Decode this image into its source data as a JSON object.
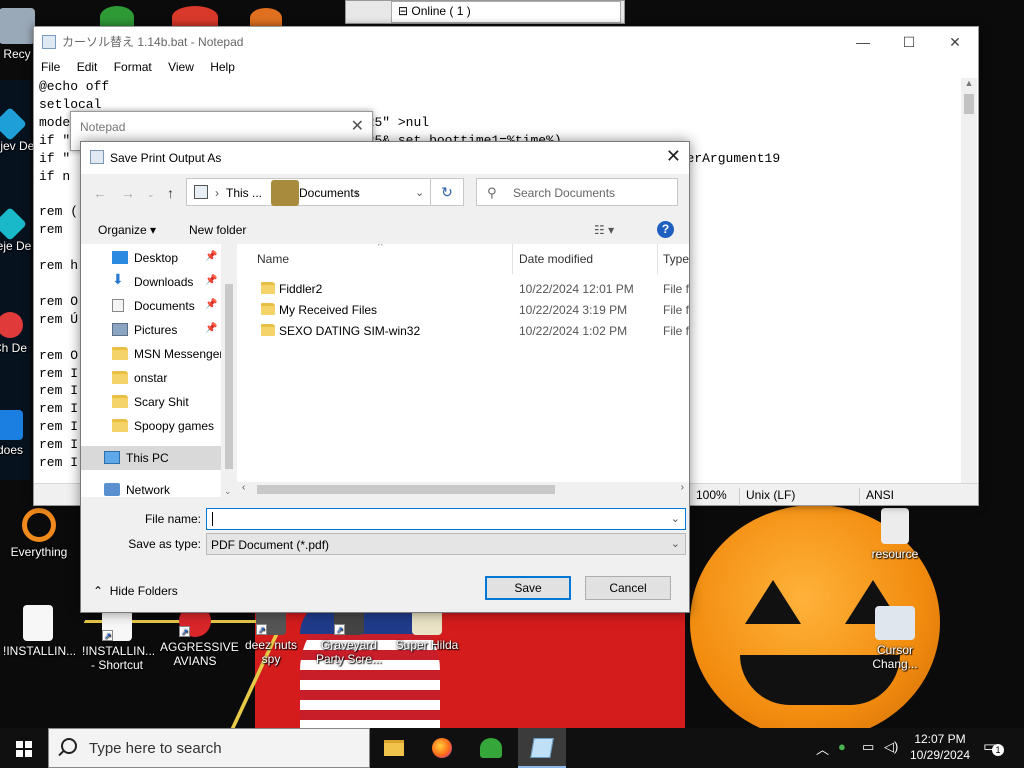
{
  "desktop": {
    "icons": [
      {
        "label": "Recy",
        "name": "recycle-bin"
      },
      {
        "label": "Bejev De",
        "name": "bejeweled-1"
      },
      {
        "label": "Beje De",
        "name": "bejeweled-2"
      },
      {
        "label": "Ch De",
        "name": "chuzzle"
      },
      {
        "label": "does",
        "name": "does"
      },
      {
        "label": "Everything",
        "name": "everything"
      },
      {
        "label": "!INSTALLIN...",
        "name": "installin-1"
      },
      {
        "label": "!INSTALLIN... - Shortcut",
        "name": "installin-shortcut"
      },
      {
        "label": "AGGRESSIVE AVIANS",
        "name": "aggressive-avians"
      },
      {
        "label": "deez nuts spy",
        "name": "deez-nuts-spy"
      },
      {
        "label": "Graveyard Party Scre...",
        "name": "graveyard-party"
      },
      {
        "label": "Super Hilda",
        "name": "super-hilda"
      },
      {
        "label": "resource",
        "name": "resource"
      },
      {
        "label": "Cursor Chang...",
        "name": "cursor-changer"
      }
    ]
  },
  "top_panel": {
    "text": "Online ( 1 )"
  },
  "notepad": {
    "title": "カーソル替え 1.14b.bat - Notepad",
    "menu": [
      "File",
      "Edit",
      "Format",
      "View",
      "Help"
    ],
    "lines": [
      "@echo off",
      "setlocal",
      "mode                                find \"25\" >nul",
      "if \"                                lines=25& set boottime1=%time%)",
      "if \"                                                         1\"==\"BatBootErrorHandlerArgument19",
      "if n",
      "",
      "rem (",
      "rem",
      "",
      "rem h",
      "",
      "rem O",
      "rem Ú",
      "",
      "rem O",
      "rem I",
      "rem I",
      "rem I",
      "rem I",
      "rem I",
      "rem I"
    ],
    "status": {
      "zoom": "100%",
      "eol": "Unix (LF)",
      "enc": "ANSI"
    }
  },
  "notepad2": {
    "title": "Notepad"
  },
  "dialog": {
    "title": "Save Print Output As",
    "crumbs": [
      "This ...",
      "Documents"
    ],
    "search_placeholder": "Search Documents",
    "organize": "Organize",
    "new_folder": "New folder",
    "nav": [
      {
        "label": "Desktop",
        "pinned": true,
        "kind": "desktop"
      },
      {
        "label": "Downloads",
        "pinned": true,
        "kind": "downloads"
      },
      {
        "label": "Documents",
        "pinned": true,
        "kind": "documents"
      },
      {
        "label": "Pictures",
        "pinned": true,
        "kind": "pictures"
      },
      {
        "label": "MSN Messenger",
        "pinned": false,
        "kind": "folder"
      },
      {
        "label": "onstar",
        "pinned": false,
        "kind": "folder"
      },
      {
        "label": "Scary Shit",
        "pinned": false,
        "kind": "folder"
      },
      {
        "label": "Spoopy games",
        "pinned": false,
        "kind": "folder"
      },
      {
        "label": "This PC",
        "pinned": false,
        "kind": "pc"
      },
      {
        "label": "Network",
        "pinned": false,
        "kind": "network"
      }
    ],
    "columns": {
      "name": "Name",
      "date": "Date modified",
      "type": "Type"
    },
    "files": [
      {
        "name": "Fiddler2",
        "date": "10/22/2024 12:01 PM",
        "type": "File fo"
      },
      {
        "name": "My Received Files",
        "date": "10/22/2024 3:19 PM",
        "type": "File fo"
      },
      {
        "name": "SEXO DATING SIM-win32",
        "date": "10/22/2024 1:02 PM",
        "type": "File fo"
      }
    ],
    "file_name_label": "File name:",
    "file_name_value": "",
    "save_type_label": "Save as type:",
    "save_type_value": "PDF Document (*.pdf)",
    "save": "Save",
    "cancel": "Cancel",
    "hide_folders": "Hide Folders"
  },
  "taskbar": {
    "search_placeholder": "Type here to search",
    "time": "12:07 PM",
    "date": "10/29/2024",
    "notifications": "1"
  },
  "colors": {
    "accent": "#0078d7",
    "folder": "#f5d36b",
    "taskbar": "#101010"
  }
}
